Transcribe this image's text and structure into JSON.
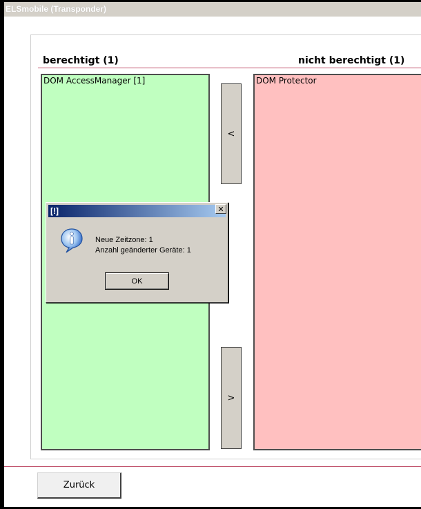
{
  "window": {
    "title": "ELSmobile (Transponder)"
  },
  "columns": {
    "left_header": "berechtigt (1)",
    "right_header": "nicht berechtigt (1)"
  },
  "left_list": {
    "items": [
      "DOM AccessManager [1]"
    ],
    "color": "#c0ffc0"
  },
  "right_list": {
    "items": [
      "DOM Protector"
    ],
    "color": "#ffc0c0"
  },
  "move_buttons": {
    "to_left_label": "<",
    "to_right_label": ">"
  },
  "footer": {
    "back_label": "Zurück"
  },
  "dialog": {
    "title": "[!]",
    "close_label": "✕",
    "icon": "info-icon",
    "line1": "Neue Zeitzone: 1",
    "line2": "Anzahl geänderter Geräte: 1",
    "ok_label": "OK"
  },
  "colors": {
    "accent_line": "#c0506a",
    "title_gradient_start": "#0a246a"
  }
}
